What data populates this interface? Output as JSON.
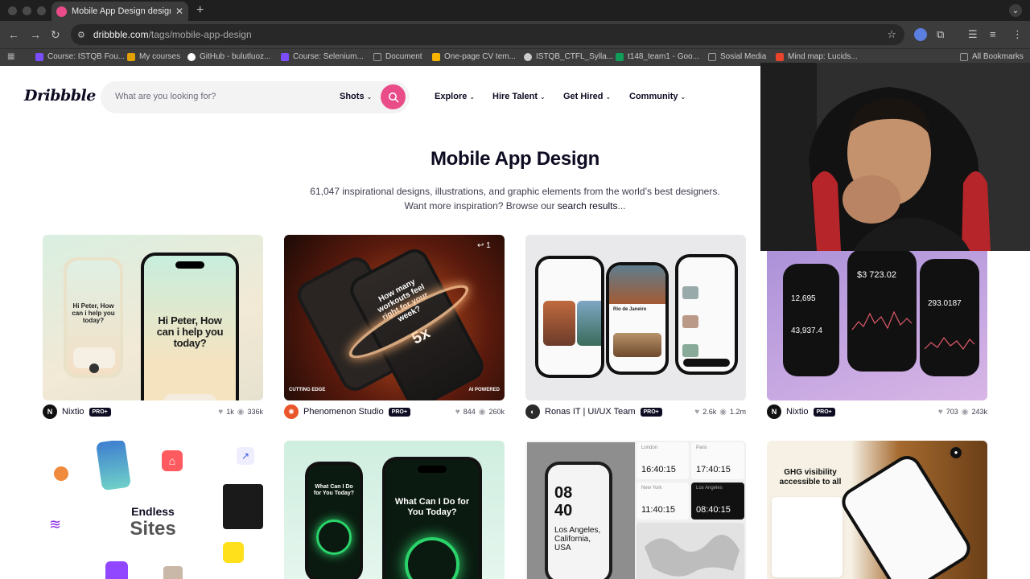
{
  "browser": {
    "tab_title": "Mobile App Design designs, t",
    "url_host": "dribbble.com",
    "url_path": "/tags/mobile-app-design",
    "bookmarks": [
      {
        "label": "Course: ISTQB Fou...",
        "color": "#7b4dff"
      },
      {
        "label": "My courses",
        "color": "#e0a000"
      },
      {
        "label": "GitHub - bulutluoz...",
        "color": "#ffffff"
      },
      {
        "label": "Course: Selenium...",
        "color": "#7b4dff"
      },
      {
        "label": "Document",
        "color": "#9a9a9a"
      },
      {
        "label": "One-page CV tem...",
        "color": "#f4b400"
      },
      {
        "label": "ISTQB_CTFL_Sylla...",
        "color": "#cccccc"
      },
      {
        "label": "t148_team1 - Goo...",
        "color": "#0f9d58"
      },
      {
        "label": "Sosial Media",
        "color": "#9a9a9a"
      },
      {
        "label": "Mind map: Lucids...",
        "color": "#e8442c"
      }
    ],
    "all_bookmarks": "All Bookmarks"
  },
  "header": {
    "logo": "Dribbble",
    "search_placeholder": "What are you looking for?",
    "search_type": "Shots",
    "nav": [
      "Explore",
      "Hire Talent",
      "Get Hired",
      "Community"
    ]
  },
  "hero": {
    "title": "Mobile App Design",
    "line1": "61,047 inspirational designs, illustrations, and graphic elements from the world’s best designers.",
    "line2_prefix": "Want more inspiration? Browse our ",
    "line2_link": "search results",
    "line2_suffix": "..."
  },
  "shots": [
    {
      "author": "Nixtio",
      "badge": "PRO+",
      "likes": "1k",
      "views": "336k",
      "avatar_color": "#111111"
    },
    {
      "author": "Phenomenon Studio",
      "badge": "PRO+",
      "likes": "844",
      "views": "260k",
      "avatar_color": "#e8562a"
    },
    {
      "author": "Ronas IT | UI/UX Team",
      "badge": "PRO+",
      "likes": "2.6k",
      "views": "1.2m",
      "avatar_color": "#2a2a2a"
    },
    {
      "author": "Nixtio",
      "badge": "PRO+",
      "likes": "703",
      "views": "243k",
      "avatar_color": "#111111"
    }
  ],
  "shot_texts": {
    "s1_small": "Hi Peter, How can i help you today?",
    "s1_big": "Hi Peter, How can i help you today?",
    "s2_main": "How many workouts feel right for your week?",
    "s2_num": "5x",
    "s2_left": "CUTTING EDGE",
    "s2_right": "AI POWERED",
    "s2_count": "1",
    "s3_title": "Rio de Janeiro",
    "s4_a": "12,695",
    "s4_b": "43,937.4",
    "s4_c": "$3 723.02",
    "s4_d": "293.0187",
    "r2_endless": "Endless",
    "r2_sites": "Sites",
    "r2_s2": "What Can I Do for You Today?",
    "r2_s3_time": "08 40",
    "r2_s3_city": "Los Angeles, California, USA",
    "r2_s3_t1": "16:40:15",
    "r2_s3_t2": "17:40:15",
    "r2_s3_t3": "11:40:15",
    "r2_s3_t4": "08:40:15",
    "r2_s3_c1": "London",
    "r2_s3_c2": "Paris",
    "r2_s3_c3": "New York",
    "r2_s3_c4": "Los Angeles",
    "r2_s4": "GHG visibility accessible to all"
  }
}
